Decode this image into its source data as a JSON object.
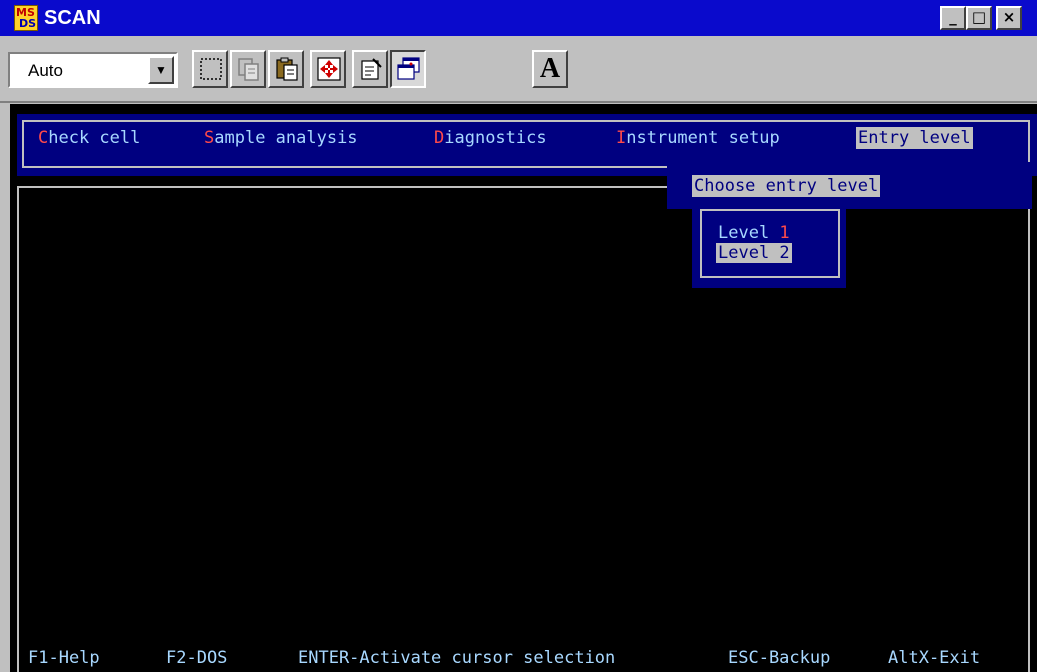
{
  "window": {
    "title": "SCAN",
    "logo_top": "MS",
    "logo_bottom": "DS",
    "minimize": "_",
    "maximize": "□",
    "close": "×"
  },
  "toolbar": {
    "font_size_value": "Auto",
    "font_size_arrow": "▼",
    "font_button_glyph": "A",
    "icons": [
      "mark-icon",
      "copy-icon",
      "paste-icon",
      "full-screen-icon",
      "properties-icon",
      "background-icon",
      "font-icon"
    ]
  },
  "menu": {
    "items": [
      {
        "hot": "C",
        "rest": "heck cell"
      },
      {
        "hot": "S",
        "rest": "ample analysis"
      },
      {
        "hot": "D",
        "rest": "iagnostics"
      },
      {
        "hot": "I",
        "rest": "nstrument setup"
      },
      {
        "hot": "",
        "rest": "Entry level"
      }
    ]
  },
  "dropdown": {
    "item": "Choose entry level"
  },
  "submenu": {
    "level1_prefix": "Level ",
    "level1_hot": "1",
    "level2": "Level 2"
  },
  "status": {
    "help": "F1-Help",
    "dos": "F2-DOS",
    "enter": "ENTER-Activate cursor selection",
    "esc": "ESC-Backup",
    "exit": "AltX-Exit"
  },
  "colors": {
    "title_bar": "#0a0acc",
    "console_bg": "#000000",
    "menu_bg": "#000080",
    "menu_text": "#a8d8ff",
    "hotkey": "#ff4a4a",
    "highlight_bg": "#c0c0c0"
  }
}
